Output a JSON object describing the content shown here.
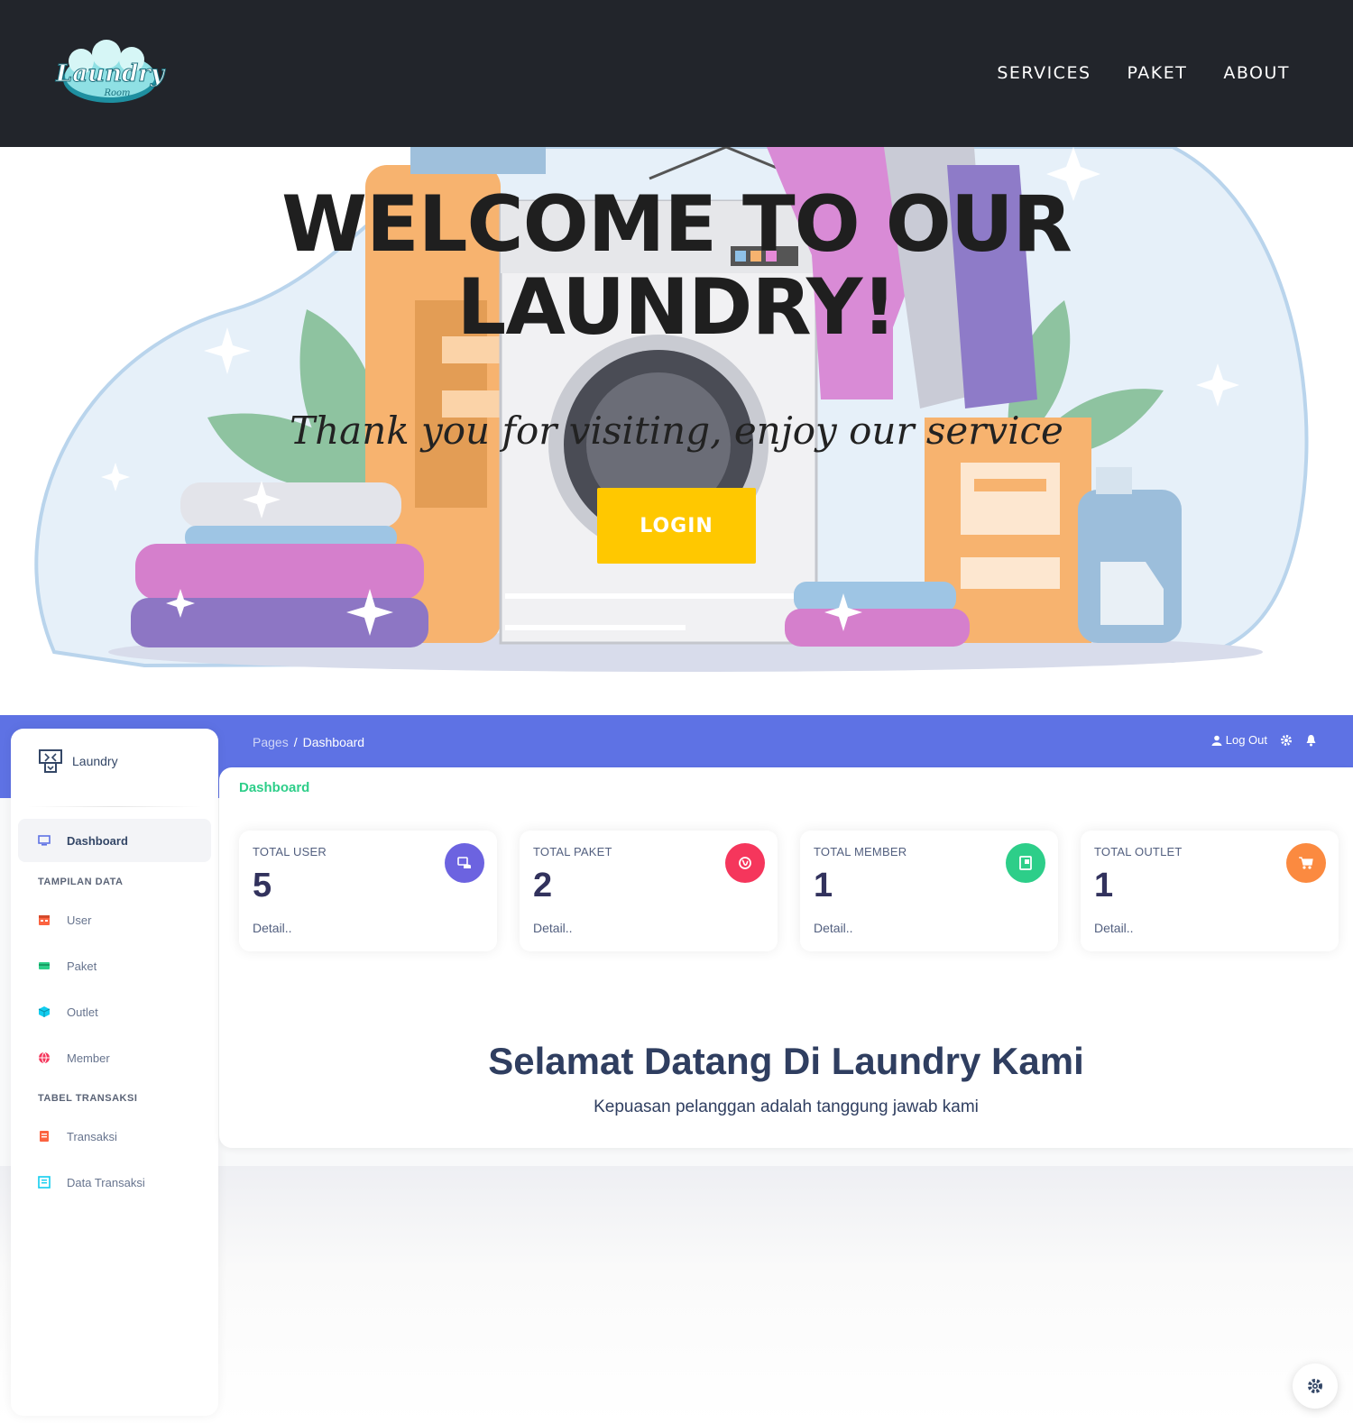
{
  "landing": {
    "logo_text": "Laundry",
    "logo_subtext": "Room",
    "nav": [
      "SERVICES",
      "PAKET",
      "ABOUT"
    ],
    "hero_title_line1": "WELCOME TO OUR",
    "hero_title_line2": "LAUNDRY!",
    "hero_subtitle": "Thank you for visiting, enjoy our service",
    "login_label": "LOGIN",
    "colors": {
      "header_bg": "#22252b",
      "login_bg": "#ffc800"
    }
  },
  "dashboard": {
    "brand": "Laundry",
    "breadcrumb": {
      "root": "Pages",
      "sep": "/",
      "current": "Dashboard"
    },
    "top_actions": {
      "logout": "Log Out"
    },
    "page_title": "Dashboard",
    "sidebar": {
      "active_item": "Dashboard",
      "section1": "TAMPILAN DATA",
      "items1": [
        "User",
        "Paket",
        "Outlet",
        "Member"
      ],
      "section2": "TABEL TRANSAKSI",
      "items2": [
        "Transaksi",
        "Data Transaksi"
      ]
    },
    "stats": [
      {
        "label": "TOTAL USER",
        "value": "5",
        "detail": "Detail..",
        "color": "#6c63e0",
        "icon": "user-db-icon"
      },
      {
        "label": "TOTAL PAKET",
        "value": "2",
        "detail": "Detail..",
        "color": "#f5365c",
        "icon": "globe-icon"
      },
      {
        "label": "TOTAL MEMBER",
        "value": "1",
        "detail": "Detail..",
        "color": "#2dce89",
        "icon": "id-card-icon"
      },
      {
        "label": "TOTAL OUTLET",
        "value": "1",
        "detail": "Detail..",
        "color": "#fb8a40",
        "icon": "cart-icon"
      }
    ],
    "welcome_title": "Selamat Datang Di Laundry Kami",
    "welcome_subtitle": "Kepuasan pelanggan adalah tanggung jawab kami",
    "colors": {
      "topband": "#5e72e4",
      "accent_green": "#2dce89",
      "text_dark": "#2f3e60"
    }
  }
}
